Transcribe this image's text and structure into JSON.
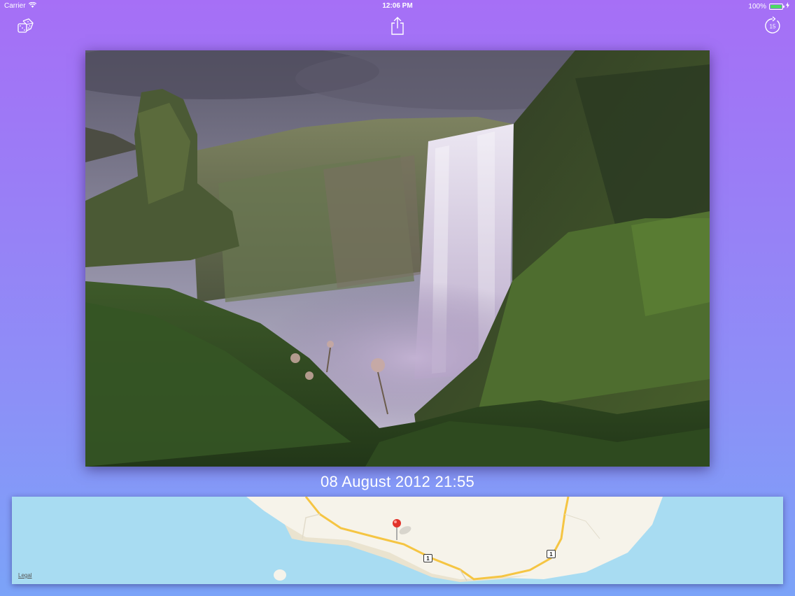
{
  "status_bar": {
    "carrier": "Carrier",
    "time": "12:06 PM",
    "battery_percent": "100%",
    "battery_level": 1.0,
    "battery_color": "#4cd964"
  },
  "toolbar": {
    "left_icon": "dice-icon",
    "center_icon": "share-icon",
    "right_icon": "replay-icon",
    "replay_count": "15"
  },
  "photo": {
    "subject": "waterfall-photo"
  },
  "date_label": "08 August 2012 21:55",
  "map": {
    "legal_label": "Legal",
    "route_badges": [
      "1",
      "1"
    ],
    "water_color": "#a8dcf2",
    "land_color": "#f6f3ea",
    "road_color": "#f5c543",
    "pin_color": "#e2332b"
  }
}
